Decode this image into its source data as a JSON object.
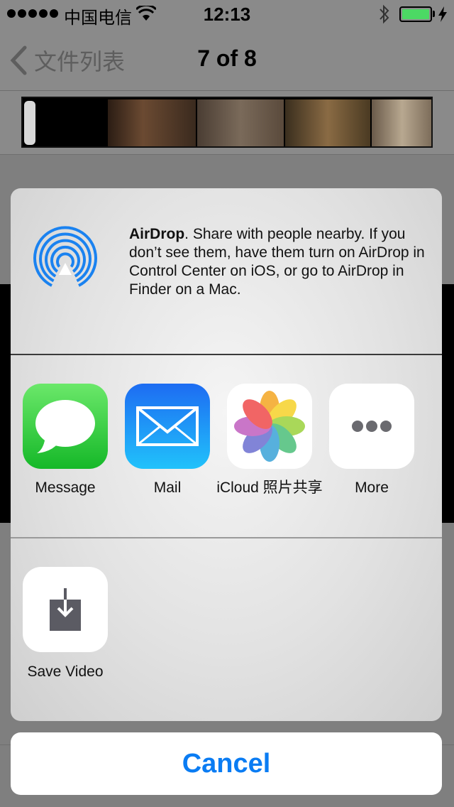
{
  "status_bar": {
    "carrier": "中国电信",
    "time": "12:13",
    "battery_level": 1.0,
    "battery_color": "#4cd964",
    "icons": [
      "signal-dots-icon",
      "wifi-icon",
      "bluetooth-icon",
      "battery-icon",
      "charging-bolt-icon"
    ]
  },
  "nav": {
    "back_label": "文件列表",
    "title": "7 of 8"
  },
  "share_sheet": {
    "airdrop": {
      "title": "AirDrop",
      "description": ". Share with people nearby. If you don’t see them, have them turn on AirDrop in Control Center on iOS, or go to AirDrop in Finder on a Mac.",
      "icon": "airdrop-icon",
      "accent": "#1a82f0"
    },
    "apps": [
      {
        "label": "Message",
        "icon": "messages-icon"
      },
      {
        "label": "Mail",
        "icon": "mail-icon"
      },
      {
        "label": "iCloud 照片共享",
        "icon": "photos-icon"
      },
      {
        "label": "More",
        "icon": "more-icon"
      }
    ],
    "actions": [
      {
        "label": "Save Video",
        "icon": "save-video-icon"
      }
    ]
  },
  "cancel_label": "Cancel",
  "colors": {
    "cancel": "#0a7cf3",
    "messages_green": "#2dc63f",
    "mail_blue": "#1e8ef5"
  }
}
